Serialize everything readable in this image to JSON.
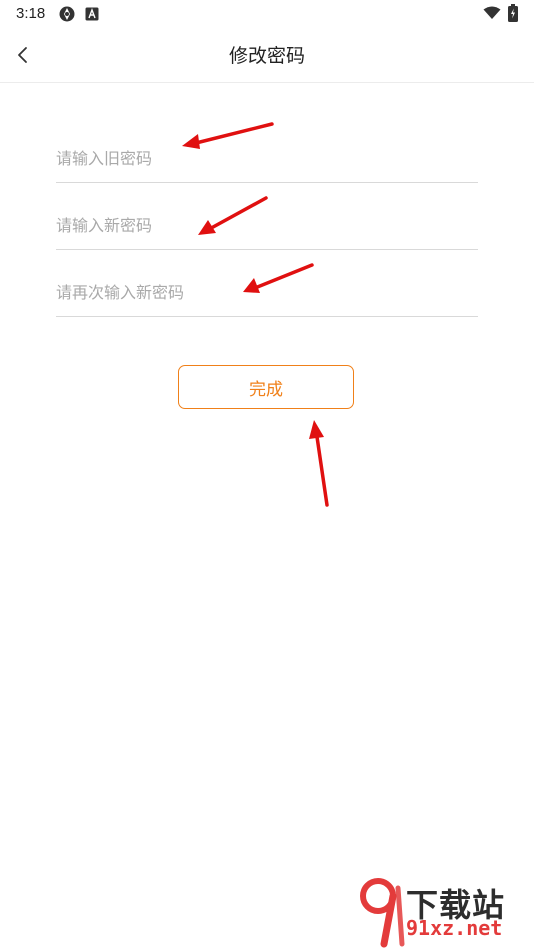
{
  "status_bar": {
    "time": "3:18",
    "icons": [
      "sync-icon",
      "a-notification-icon",
      "wifi-icon",
      "battery-charging-icon"
    ]
  },
  "header": {
    "title": "修改密码",
    "back_icon": "chevron-left-icon"
  },
  "form": {
    "old_password": {
      "placeholder": "请输入旧密码",
      "value": ""
    },
    "new_password": {
      "placeholder": "请输入新密码",
      "value": ""
    },
    "confirm_password": {
      "placeholder": "请再次输入新密码",
      "value": ""
    },
    "submit_label": "完成"
  },
  "watermark": {
    "top_text": "下载站",
    "bottom_text": "91xz.net"
  },
  "colors": {
    "accent": "#f08019",
    "annotation_arrow": "#e01010",
    "divider": "#d9d9d9"
  }
}
